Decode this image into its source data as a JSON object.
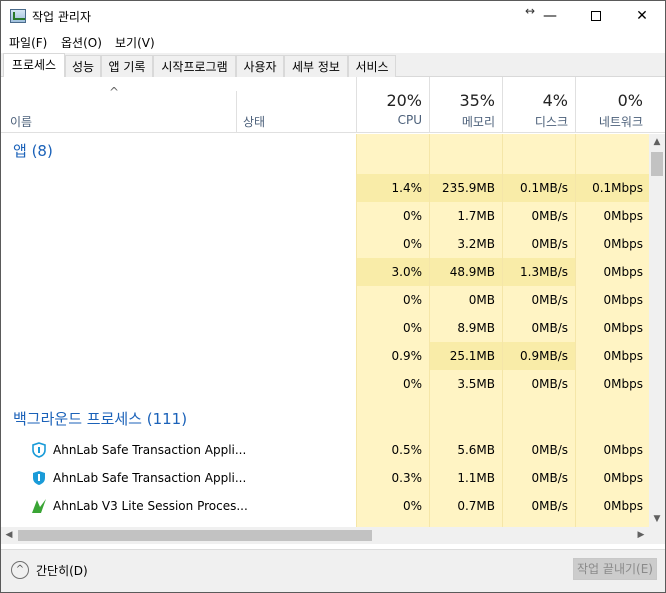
{
  "window": {
    "title": "작업 관리자",
    "resize_glyph": "↔",
    "minimize_glyph": "—",
    "maximize_glyph": "☐",
    "close_glyph": "✕"
  },
  "menu": [
    "파일(F)",
    "옵션(O)",
    "보기(V)"
  ],
  "tabs": [
    "프로세스",
    "성능",
    "앱 기록",
    "시작프로그램",
    "사용자",
    "세부 정보",
    "서비스"
  ],
  "header": {
    "sort_glyph": "^",
    "name": "이름",
    "status": "상태",
    "columns": [
      {
        "pct": "20%",
        "label": "CPU"
      },
      {
        "pct": "35%",
        "label": "메모리"
      },
      {
        "pct": "4%",
        "label": "디스크"
      },
      {
        "pct": "0%",
        "label": "네트워크"
      }
    ]
  },
  "groups": {
    "apps": "앱 (8)",
    "background": "백그라운드 프로세스 (111)"
  },
  "app_rows": [
    {
      "cpu": "1.4%",
      "mem": "235.9MB",
      "disk": "0.1MB/s",
      "net": "0.1Mbps"
    },
    {
      "cpu": "0%",
      "mem": "1.7MB",
      "disk": "0MB/s",
      "net": "0Mbps"
    },
    {
      "cpu": "0%",
      "mem": "3.2MB",
      "disk": "0MB/s",
      "net": "0Mbps"
    },
    {
      "cpu": "3.0%",
      "mem": "48.9MB",
      "disk": "1.3MB/s",
      "net": "0Mbps"
    },
    {
      "cpu": "0%",
      "mem": "0MB",
      "disk": "0MB/s",
      "net": "0Mbps"
    },
    {
      "cpu": "0%",
      "mem": "8.9MB",
      "disk": "0MB/s",
      "net": "0Mbps"
    },
    {
      "cpu": "0.9%",
      "mem": "25.1MB",
      "disk": "0.9MB/s",
      "net": "0Mbps"
    },
    {
      "cpu": "0%",
      "mem": "3.5MB",
      "disk": "0MB/s",
      "net": "0Mbps"
    }
  ],
  "bg_rows": [
    {
      "name": "AhnLab Safe Transaction Appli...",
      "icon": "shield-outline-icon",
      "cpu": "0.5%",
      "mem": "5.6MB",
      "disk": "0MB/s",
      "net": "0Mbps"
    },
    {
      "name": "AhnLab Safe Transaction Appli...",
      "icon": "shield-filled-icon",
      "cpu": "0.3%",
      "mem": "1.1MB",
      "disk": "0MB/s",
      "net": "0Mbps"
    },
    {
      "name": "AhnLab V3 Lite Session Proces...",
      "icon": "v3-leaf-icon",
      "cpu": "0%",
      "mem": "0.7MB",
      "disk": "0MB/s",
      "net": "0Mbps"
    }
  ],
  "scroll_glyphs": {
    "up": "▲",
    "down": "▼",
    "left": "◀",
    "right": "▶"
  },
  "footer": {
    "collapse_glyph": "^",
    "collapse_label": "간단히(D)",
    "end_task": "작업 끝내기(E)"
  },
  "colors": {
    "group_title": "#1b62b9",
    "heat_light": "#fff4c4",
    "heat_mid": "#f9eca8",
    "heat_strong": "#f6e39a"
  }
}
